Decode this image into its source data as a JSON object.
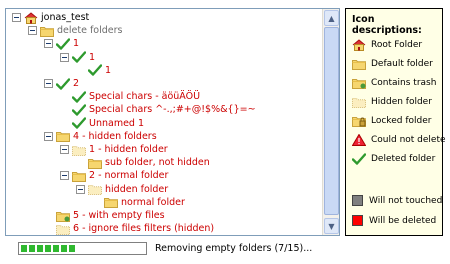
{
  "tree": [
    {
      "id": "root",
      "label": "jonas_test",
      "icon": "root-folder-icon",
      "color": "black",
      "level": 0,
      "expander": true
    },
    {
      "id": "delete-folders",
      "label": "delete folders",
      "icon": "default-folder-icon",
      "color": "gray",
      "level": 1,
      "expander": true
    },
    {
      "id": "n1",
      "label": "1",
      "icon": "deleted-check-icon",
      "color": "red",
      "level": 2,
      "expander": true
    },
    {
      "id": "n1-1",
      "label": "1",
      "icon": "deleted-check-icon",
      "color": "red",
      "level": 3,
      "expander": true
    },
    {
      "id": "n1-1-1",
      "label": "1",
      "icon": "deleted-check-icon",
      "color": "red",
      "level": 4,
      "expander": false
    },
    {
      "id": "n2",
      "label": "2",
      "icon": "deleted-check-icon",
      "color": "red",
      "level": 2,
      "expander": true
    },
    {
      "id": "special1",
      "label": "Special chars - äöüÄÖÜ",
      "icon": "deleted-check-icon",
      "color": "red",
      "level": 3,
      "expander": false
    },
    {
      "id": "special2",
      "label": "Special chars ^-.,;#+@!$%&{}=~",
      "icon": "deleted-check-icon",
      "color": "red",
      "level": 3,
      "expander": false
    },
    {
      "id": "unnamed1",
      "label": "Unnamed 1",
      "icon": "deleted-check-icon",
      "color": "red",
      "level": 3,
      "expander": false
    },
    {
      "id": "n4",
      "label": "4 - hidden folders",
      "icon": "default-folder-icon",
      "color": "red",
      "level": 2,
      "expander": true
    },
    {
      "id": "hidden1",
      "label": "1 - hidden folder",
      "icon": "hidden-folder-icon",
      "color": "red",
      "level": 3,
      "expander": true
    },
    {
      "id": "subfolder",
      "label": "sub folder, not hidden",
      "icon": "default-folder-icon",
      "color": "red",
      "level": 4,
      "expander": false
    },
    {
      "id": "normal2",
      "label": "2 - normal folder",
      "icon": "default-folder-icon",
      "color": "red",
      "level": 3,
      "expander": true
    },
    {
      "id": "hidden-f",
      "label": "hidden folder",
      "icon": "hidden-folder-icon",
      "color": "red",
      "level": 4,
      "expander": true
    },
    {
      "id": "normal-f",
      "label": "normal folder",
      "icon": "default-folder-icon",
      "color": "red",
      "level": 5,
      "expander": false
    },
    {
      "id": "n5",
      "label": "5 - with empty files",
      "icon": "contains-trash-icon",
      "color": "red",
      "level": 2,
      "expander": false
    },
    {
      "id": "n6",
      "label": "6 - ignore files filters (hidden)",
      "icon": "hidden-folder-icon",
      "color": "red",
      "level": 2,
      "expander": false
    }
  ],
  "legend": {
    "title": "Icon descriptions:",
    "items": [
      {
        "icon": "root-folder-icon",
        "label": "Root Folder"
      },
      {
        "icon": "default-folder-icon",
        "label": "Default folder"
      },
      {
        "icon": "contains-trash-icon",
        "label": "Contains trash"
      },
      {
        "icon": "hidden-folder-icon",
        "label": "Hidden folder"
      },
      {
        "icon": "locked-folder-icon",
        "label": "Locked folder"
      },
      {
        "icon": "warning-icon",
        "label": "Could not delete"
      },
      {
        "icon": "deleted-check-icon",
        "label": "Deleted folder"
      }
    ],
    "swatches": [
      {
        "color": "#808080",
        "label": "Will not touched"
      },
      {
        "color": "#ff0000",
        "label": "Will be deleted"
      }
    ]
  },
  "status": {
    "text": "Removing empty folders (7/15)...",
    "progress": 0.4667,
    "progress_blocks": 7
  },
  "colors": {
    "red": "#cc0000",
    "gray": "#6d6d6d",
    "black": "#000000",
    "check": "#2e9a2e",
    "folder": "#f5d46b"
  }
}
